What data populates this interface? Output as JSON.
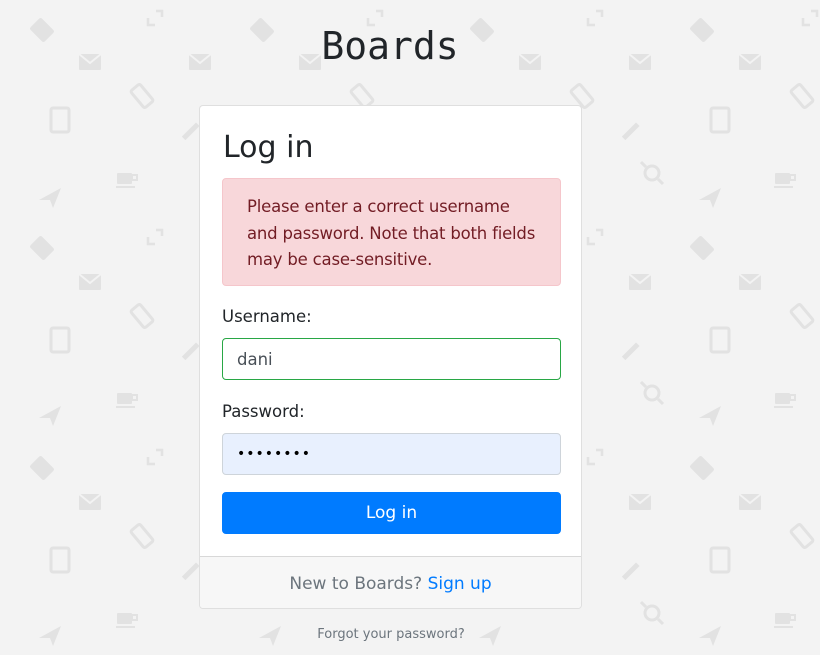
{
  "brand": "Boards",
  "login": {
    "title": "Log in",
    "error_message": "Please enter a correct username and password. Note that both fields may be case-sensitive.",
    "username_label": "Username:",
    "username_value": "dani",
    "password_label": "Password:",
    "password_value": "••••••••",
    "submit_label": "Log in"
  },
  "footer": {
    "prompt": "New to Boards?",
    "signup_label": "Sign up"
  },
  "forgot_password": "Forgot your password?",
  "background_icons": [
    "pen-icon",
    "envelope-icon",
    "phone-icon",
    "tablet-icon",
    "pencil-icon",
    "paper-plane-icon",
    "coffee-cup-icon",
    "expand-icon",
    "tag-icon"
  ],
  "colors": {
    "primary": "#007bff",
    "alert_bg": "#f8d7da",
    "alert_text": "#721c24",
    "valid_border": "#28a745",
    "autofill_bg": "#e8f0fe",
    "page_bg": "#f3f3f3"
  }
}
